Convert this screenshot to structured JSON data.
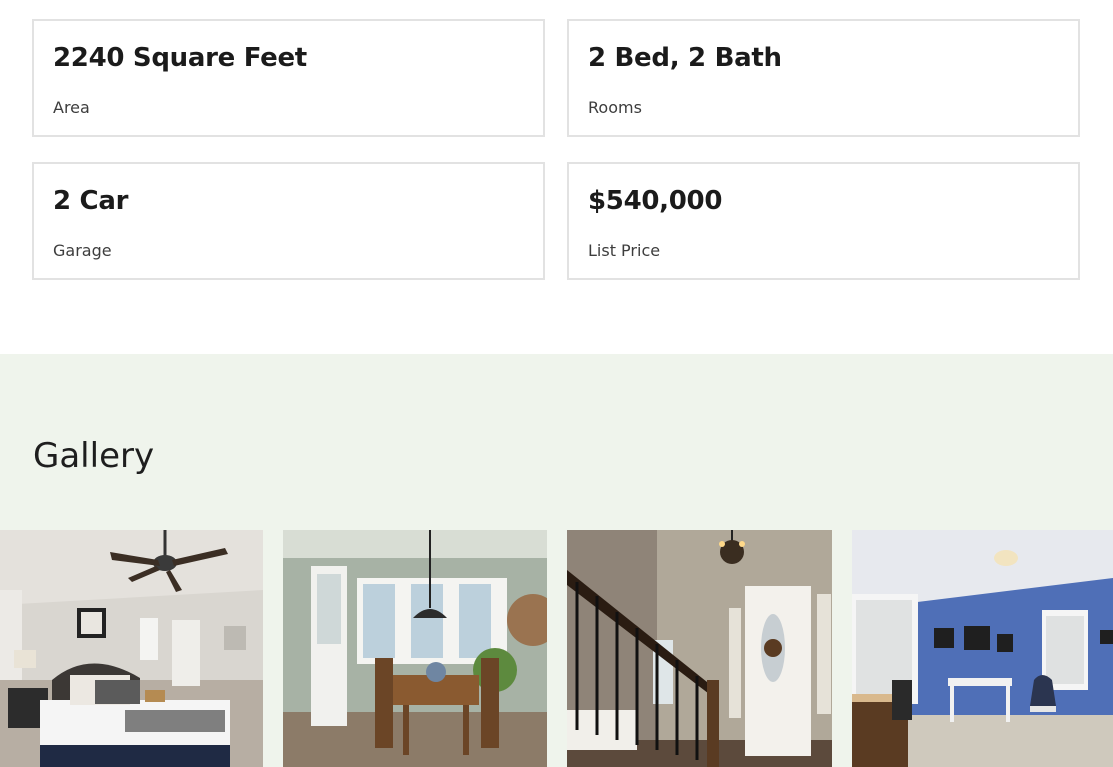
{
  "facts": [
    {
      "value": "2240 Square Feet",
      "label": "Area"
    },
    {
      "value": "2 Bed, 2 Bath",
      "label": "Rooms"
    },
    {
      "value": "2 Car",
      "label": "Garage"
    },
    {
      "value": "$540,000",
      "label": "List Price"
    }
  ],
  "gallery": {
    "title": "Gallery",
    "photos": [
      "bedroom-photo",
      "dining-nook-photo",
      "entry-foyer-photo",
      "office-photo"
    ]
  },
  "colors": {
    "gallery_bg": "#eff4ec",
    "card_border": "#e2e2e2",
    "text": "#1e1e1e"
  }
}
